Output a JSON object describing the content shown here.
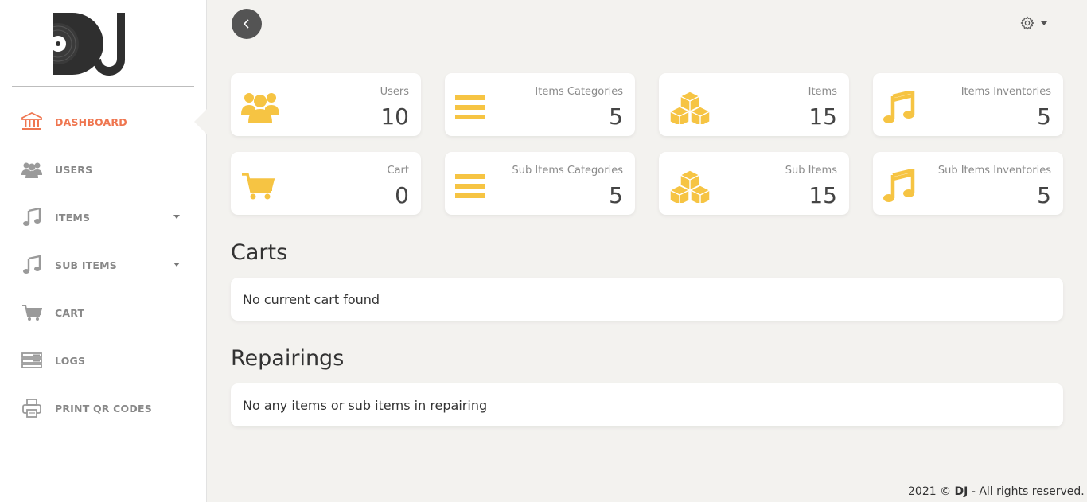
{
  "brand": {
    "logo_text": "DJ"
  },
  "sidebar": {
    "items": [
      {
        "label": "DASHBOARD",
        "icon": "bank-icon",
        "active": true
      },
      {
        "label": "USERS",
        "icon": "users-icon"
      },
      {
        "label": "ITEMS",
        "icon": "music-note-icon",
        "has_submenu": true
      },
      {
        "label": "SUB ITEMS",
        "icon": "music-note-icon",
        "has_submenu": true
      },
      {
        "label": "CART",
        "icon": "cart-icon"
      },
      {
        "label": "LOGS",
        "icon": "server-icon"
      },
      {
        "label": "PRINT QR CODES",
        "icon": "printer-icon"
      }
    ]
  },
  "topbar": {
    "back_icon": "chevron-left-icon",
    "settings_icon": "gear-icon"
  },
  "cards": [
    {
      "title": "Users",
      "value": "10",
      "icon": "users-icon"
    },
    {
      "title": "Items Categories",
      "value": "5",
      "icon": "bars-icon"
    },
    {
      "title": "Items",
      "value": "15",
      "icon": "cubes-icon"
    },
    {
      "title": "Items Inventories",
      "value": "5",
      "icon": "music-note-icon"
    },
    {
      "title": "Cart",
      "value": "0",
      "icon": "cart-icon"
    },
    {
      "title": "Sub Items Categories",
      "value": "5",
      "icon": "bars-icon"
    },
    {
      "title": "Sub Items",
      "value": "15",
      "icon": "cubes-icon"
    },
    {
      "title": "Sub Items Inventories",
      "value": "5",
      "icon": "music-note-icon"
    }
  ],
  "sections": {
    "carts": {
      "title": "Carts",
      "message": "No current cart found"
    },
    "repairings": {
      "title": "Repairings",
      "message": "No any items or sub items in repairing"
    }
  },
  "footer": {
    "prefix": "2021 © ",
    "brand": "DJ",
    "suffix": " - All rights reserved."
  },
  "colors": {
    "accent": "#ef7650",
    "card_icon": "#f6c443",
    "sidebar_icon": "#9a9a9a",
    "back_button": "#545454",
    "background": "#f3f2ef"
  }
}
